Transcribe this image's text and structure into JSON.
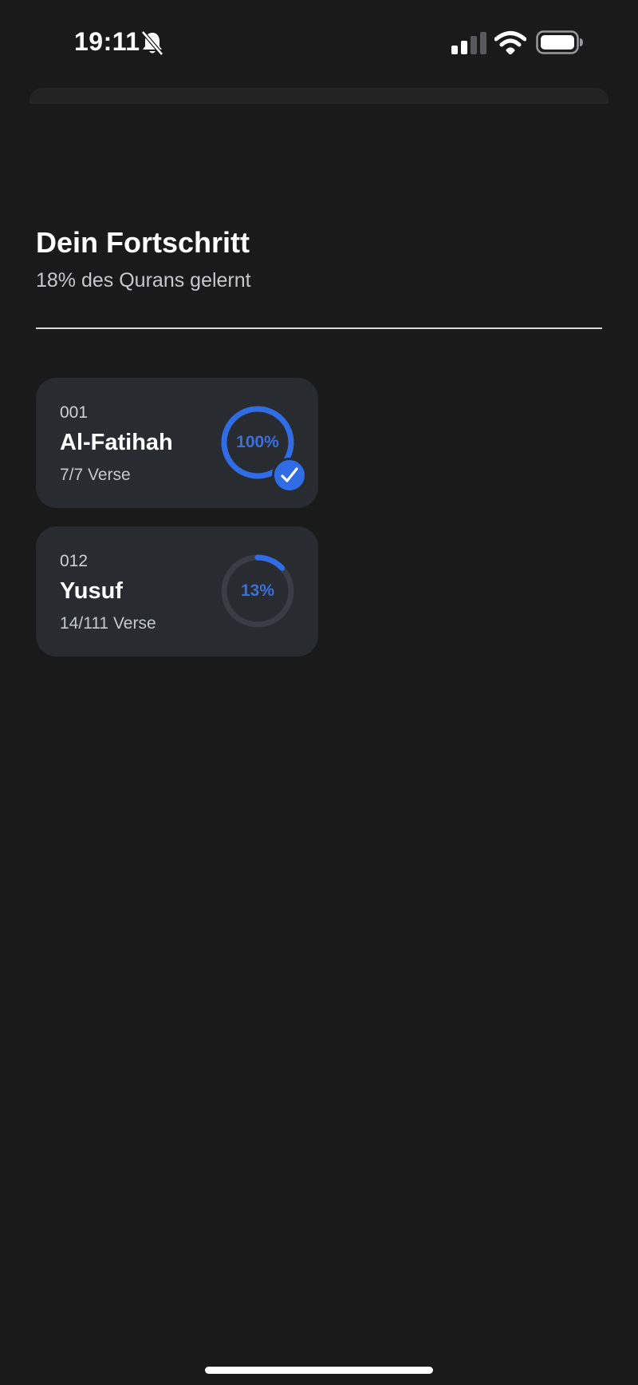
{
  "status_bar": {
    "time": "19:11",
    "icons": [
      "bell-slash-icon",
      "cellular-signal-icon",
      "wifi-icon",
      "battery-icon"
    ]
  },
  "header": {
    "title": "Dein Fortschritt",
    "subtitle": "18% des Qurans gelernt"
  },
  "surahs": [
    {
      "number": "001",
      "name": "Al-Fatihah",
      "verses": "7/7 Verse",
      "progress_label": "100%",
      "progress": 1.0,
      "completed": true
    },
    {
      "number": "012",
      "name": "Yusuf",
      "verses": "14/111 Verse",
      "progress_label": "13%",
      "progress": 0.13,
      "completed": false
    }
  ],
  "colors": {
    "background": "#1a1a1a",
    "card": "#282b2f",
    "accent": "#2f6ce5",
    "ring_track": "#3a3d44"
  }
}
